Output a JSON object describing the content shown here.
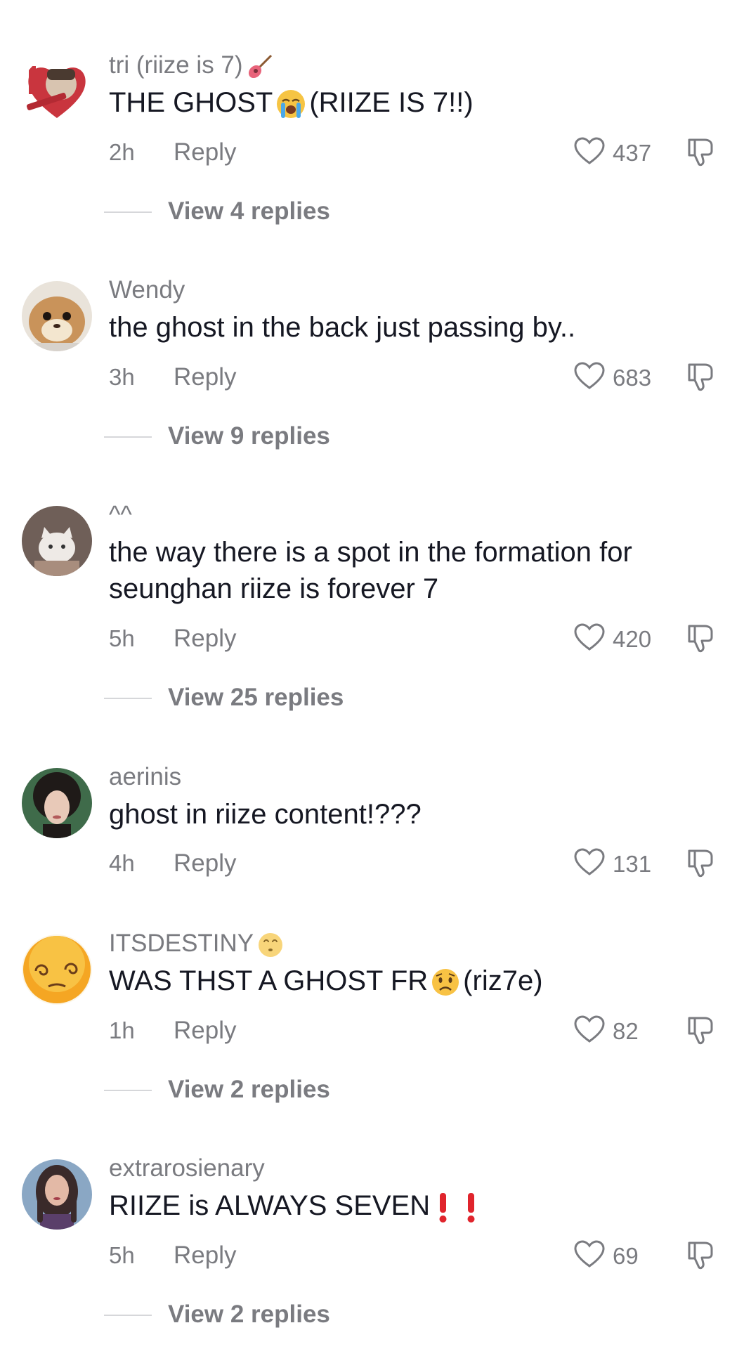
{
  "comments": [
    {
      "username": "tri (riize is 7)",
      "username_deco": "guitar-emoji",
      "text_before": "THE GHOST",
      "text_deco": "loudly-crying-emoji",
      "text_after": "(RIIZE IS 7!!)",
      "time": "2h",
      "reply_label": "Reply",
      "likes": "437",
      "view_replies": "View 4 replies"
    },
    {
      "username": "Wendy",
      "text": "the ghost in the back just passing by..",
      "time": "3h",
      "reply_label": "Reply",
      "likes": "683",
      "view_replies": "View 9 replies"
    },
    {
      "username": "^^",
      "text": "the way there is a spot in the formation for seunghan riize is forever 7",
      "time": "5h",
      "reply_label": "Reply",
      "likes": "420",
      "view_replies": "View 25 replies"
    },
    {
      "username": "aerinis",
      "text": "ghost in riize content!???",
      "time": "4h",
      "reply_label": "Reply",
      "likes": "131"
    },
    {
      "username": "ITSDESTINY",
      "username_deco": "dizzy-face-emoji",
      "text_before": "WAS THST A GHOST FR",
      "text_deco": "worried-face-emoji",
      "text_after": "(riz7e)",
      "time": "1h",
      "reply_label": "Reply",
      "likes": "82",
      "view_replies": "View 2 replies"
    },
    {
      "username": "extrarosienary",
      "text_before": "RIIZE is ALWAYS SEVEN",
      "text_deco": "double-exclamation-emoji",
      "time": "5h",
      "reply_label": "Reply",
      "likes": "69",
      "view_replies": "View 2 replies"
    }
  ],
  "colors": {
    "text_primary": "#161823",
    "text_secondary": "#7a7b80",
    "divider": "#d6d7da",
    "exclamation_red": "#e0242c"
  }
}
